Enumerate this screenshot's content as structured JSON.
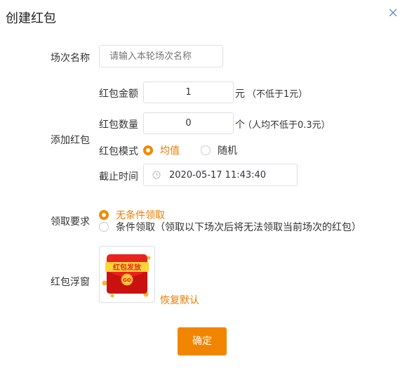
{
  "dialog": {
    "title": "创建红包",
    "close_icon": "close-icon"
  },
  "session_name": {
    "label": "场次名称",
    "placeholder": "请输入本轮场次名称"
  },
  "add_redpacket": {
    "label": "添加红包",
    "amount": {
      "label": "红包金额",
      "value": "1",
      "unit": "元",
      "hint": "（不低于1元）"
    },
    "count": {
      "label": "红包数量",
      "value": "0",
      "unit": "个",
      "hint": "（人均不低于0.3元）"
    },
    "mode": {
      "label": "红包模式",
      "options": [
        "均值",
        "随机"
      ],
      "selected": "均值"
    },
    "deadline": {
      "label": "截止时间",
      "value": "2020-05-17 11:43:40",
      "icon": "clock-icon"
    }
  },
  "requirement": {
    "label": "领取要求",
    "options": [
      "无条件领取",
      "条件领取（领取以下场次后将无法领取当前场次的红包）"
    ],
    "selected": "无条件领取"
  },
  "float_window": {
    "label": "红包浮窗",
    "image_text": "红包发放",
    "go_text": "GO",
    "reset_link": "恢复默认"
  },
  "confirm_button": "确定",
  "colors": {
    "accent": "#f28500",
    "selected_text": "#ef7a00",
    "border": "#dcdfe6",
    "envelope_red": "#e8231e"
  }
}
